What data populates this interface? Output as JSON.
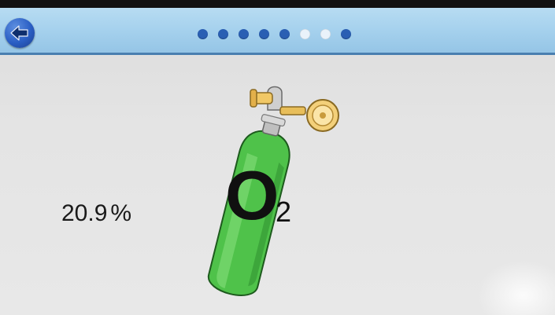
{
  "header": {
    "back_icon": "arrow-left-icon",
    "pager": {
      "total": 8,
      "active": [
        1,
        2,
        3,
        4,
        5,
        8
      ]
    }
  },
  "main": {
    "reading_value": "20.9",
    "reading_unit": "%",
    "gas_symbol": "O",
    "gas_subscript": "2",
    "cylinder_icon": "oxygen-cylinder-icon"
  },
  "colors": {
    "header_bg": "#a7d2ee",
    "accent_blue": "#2a5fb3",
    "cylinder_green": "#3fb83f",
    "valve_gold": "#e3b04a"
  }
}
